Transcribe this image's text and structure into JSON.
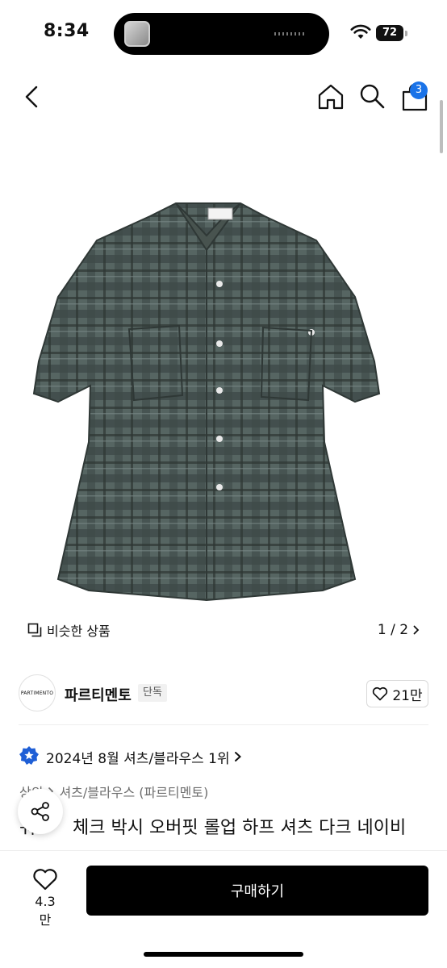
{
  "status_bar": {
    "time": "8:34",
    "battery": "72"
  },
  "nav": {
    "cart_count": "3"
  },
  "gallery": {
    "similar_label": "비슷한 상품",
    "pager": "1 / 2"
  },
  "brand": {
    "logo_text": "PARTIMENTO",
    "name": "파르티멘토",
    "badge": "단독",
    "likes": "21만"
  },
  "ranking": {
    "text": "2024년 8월 셔츠/블라우스 1위"
  },
  "breadcrumb": {
    "level1": "상의",
    "level2": "셔츠/블라우스 (파르티멘토)"
  },
  "product": {
    "title_partial": "워",
    "title": "체크 박시 오버핏 롤업 하프 셔츠 다크 네이비"
  },
  "bottom_bar": {
    "wish_count": "4.3만",
    "buy_label": "구매하기"
  },
  "colors": {
    "accent": "#1a73e8",
    "buy_button": "#000000",
    "shirt": "#4b5a58"
  },
  "icons": [
    "back-icon",
    "home-icon",
    "search-icon",
    "bag-icon",
    "similar-icon",
    "chevron-right-icon",
    "heart-icon",
    "rank-badge-icon",
    "share-icon",
    "wifi-icon"
  ]
}
